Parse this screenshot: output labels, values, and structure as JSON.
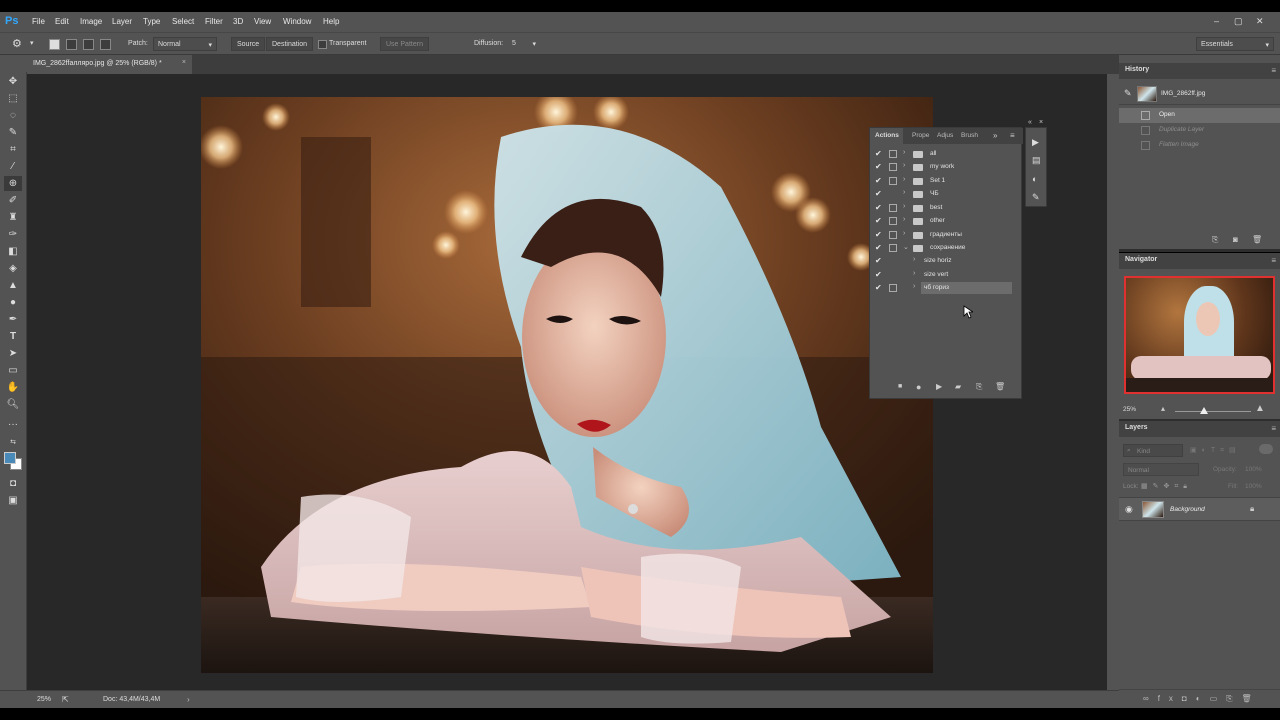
{
  "app": {
    "logo": "Ps"
  },
  "menu": [
    "File",
    "Edit",
    "Image",
    "Layer",
    "Type",
    "Select",
    "Filter",
    "3D",
    "View",
    "Window",
    "Help"
  ],
  "window_controls": [
    "–",
    "▢",
    "✕"
  ],
  "options_bar": {
    "patch_label": "Patch:",
    "patch_mode": "Normal",
    "source_label": "Source",
    "destination_label": "Destination",
    "transparent_label": "Transparent",
    "use_pattern_label": "Use Pattern",
    "diffusion_label": "Diffusion:",
    "diffusion_value": "5",
    "workspace": "Essentials"
  },
  "document": {
    "tab_title": "IMG_2862ffалляро.jpg @ 25% (RGB/8) *",
    "tab_close": "×"
  },
  "status": {
    "zoom": "25%",
    "doc_size": "Doc: 43,4M/43,4M"
  },
  "history": {
    "title": "History",
    "snapshot_name": "IMG_2862ff.jpg",
    "items": [
      {
        "label": "Open",
        "state": "active"
      },
      {
        "label": "Duplicate Layer",
        "state": "undone"
      },
      {
        "label": "Flatten Image",
        "state": "undone"
      }
    ]
  },
  "navigator": {
    "title": "Navigator",
    "zoom": "25%"
  },
  "layers": {
    "title": "Layers",
    "search_placeholder": "Kind",
    "blend_mode": "Normal",
    "opacity_label": "Opacity:",
    "opacity_value": "100%",
    "lock_label": "Lock:",
    "fill_label": "Fill:",
    "fill_value": "100%",
    "items": [
      {
        "name": "Background"
      }
    ]
  },
  "actions": {
    "tabs": [
      "Actions",
      "Prope",
      "Adjus",
      "Brush"
    ],
    "rows": [
      {
        "label": "all",
        "type": "set"
      },
      {
        "label": "my work",
        "type": "set"
      },
      {
        "label": "Set 1",
        "type": "set"
      },
      {
        "label": "ЧБ",
        "type": "set"
      },
      {
        "label": "best",
        "type": "set"
      },
      {
        "label": "other",
        "type": "set"
      },
      {
        "label": "градиенты",
        "type": "set"
      },
      {
        "label": "сохранение",
        "type": "set-open"
      },
      {
        "label": "size horiz",
        "type": "action"
      },
      {
        "label": "size vert",
        "type": "action"
      },
      {
        "label": "чб гориз",
        "type": "action-selected"
      }
    ]
  },
  "colors": {
    "panel_bg": "#535353",
    "canvas_bg": "#282828",
    "foreground": "#4a8ab8",
    "background": "#ffffff",
    "accent": "#31a8ff"
  }
}
